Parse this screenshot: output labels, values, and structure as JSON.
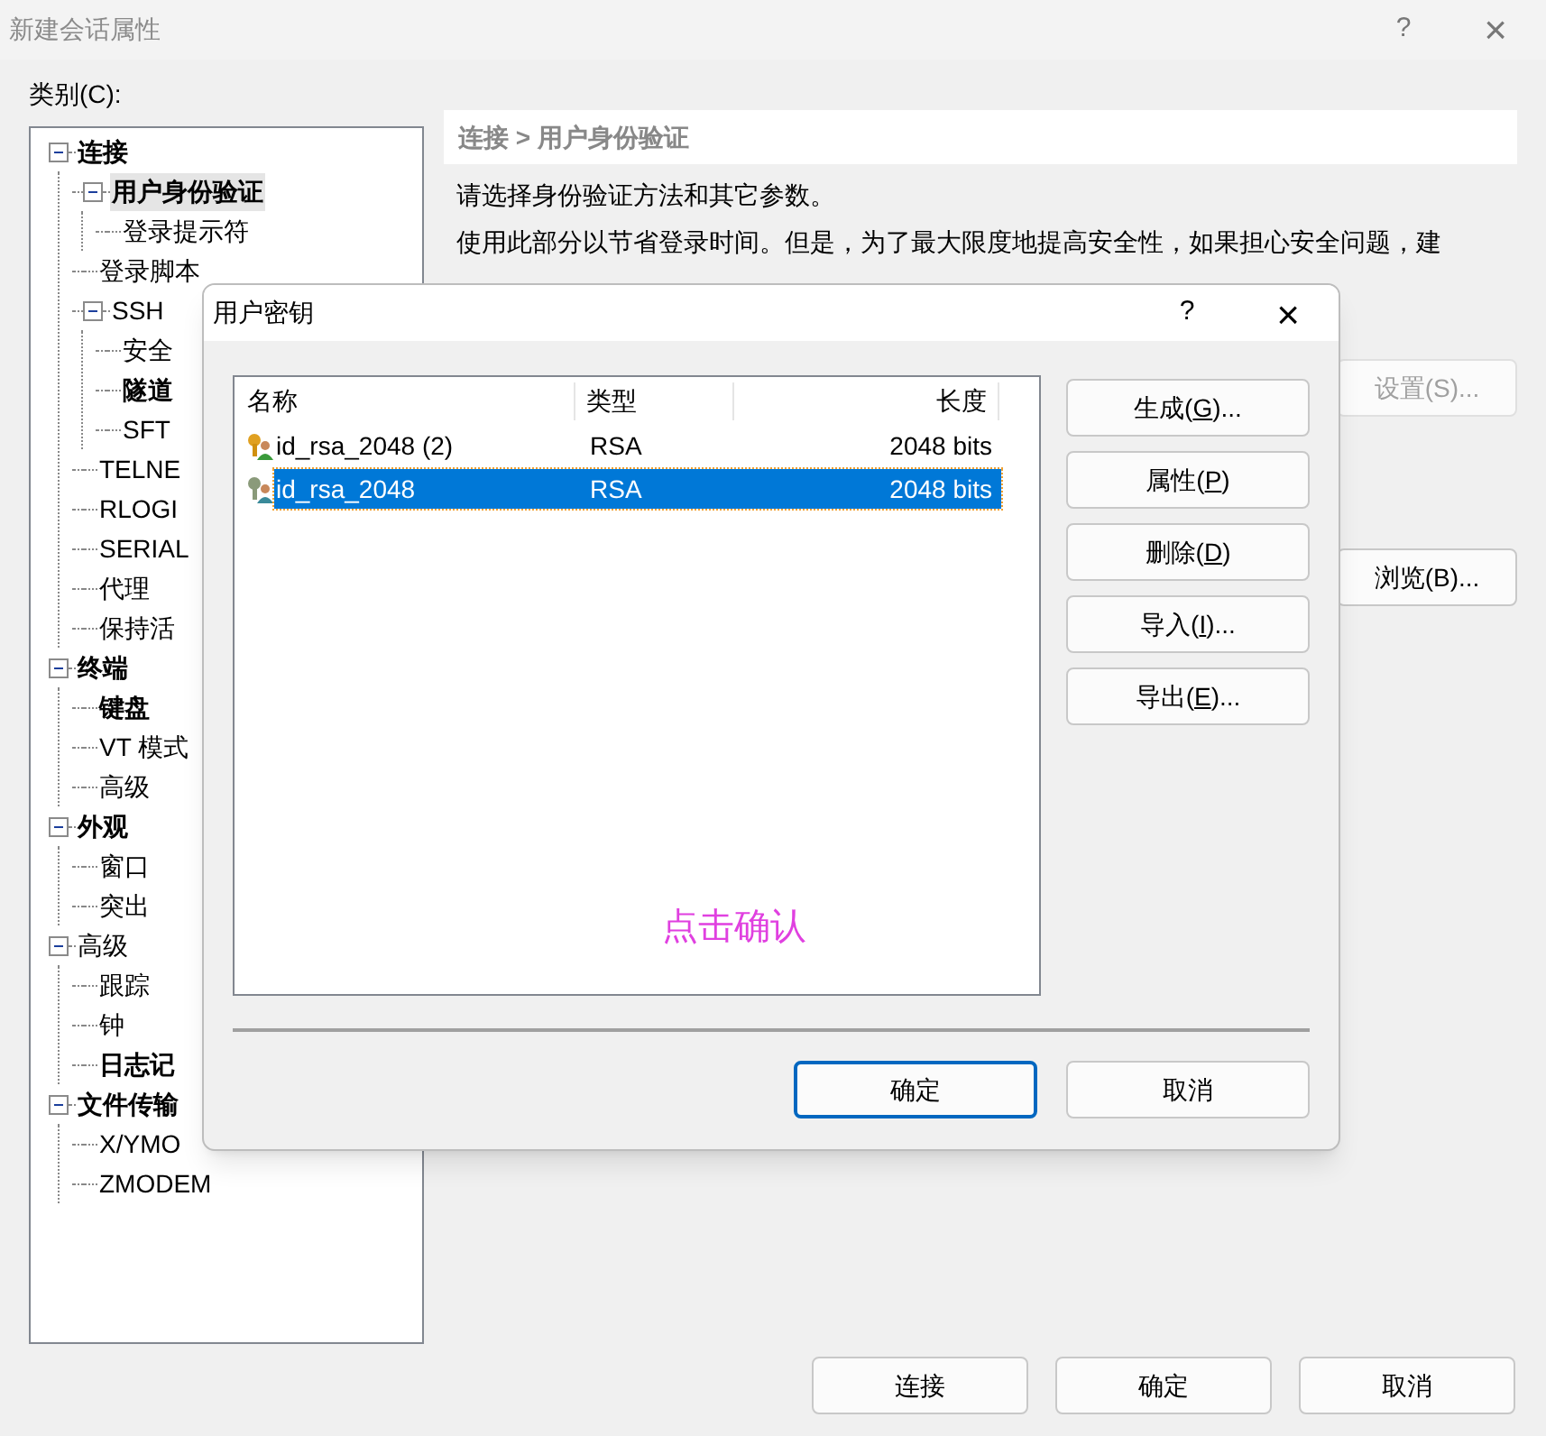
{
  "window": {
    "title": "新建会话属性",
    "help": "?",
    "close": "×"
  },
  "category_label": "类别(C):",
  "tree": [
    {
      "label": "连接",
      "bold": true,
      "expanded": true,
      "selected": false,
      "children": [
        {
          "label": "用户身份验证",
          "bold": true,
          "expanded": true,
          "selected": true,
          "children": [
            {
              "label": "登录提示符",
              "bold": false,
              "selected": false
            }
          ]
        },
        {
          "label": "登录脚本",
          "bold": false,
          "selected": false
        },
        {
          "label": "SSH",
          "bold": false,
          "expanded": true,
          "selected": false,
          "children": [
            {
              "label": "安全",
              "bold": false,
              "selected": false
            },
            {
              "label": "隧道",
              "bold": true,
              "selected": false
            },
            {
              "label": "SFT",
              "bold": false,
              "selected": false
            }
          ]
        },
        {
          "label": "TELNE",
          "bold": false,
          "selected": false
        },
        {
          "label": "RLOGI",
          "bold": false,
          "selected": false
        },
        {
          "label": "SERIAL",
          "bold": false,
          "selected": false
        },
        {
          "label": "代理",
          "bold": false,
          "selected": false
        },
        {
          "label": "保持活",
          "bold": false,
          "selected": false
        }
      ]
    },
    {
      "label": "终端",
      "bold": true,
      "expanded": true,
      "selected": false,
      "children": [
        {
          "label": "键盘",
          "bold": true,
          "selected": false
        },
        {
          "label": "VT 模式",
          "bold": false,
          "selected": false
        },
        {
          "label": "高级",
          "bold": false,
          "selected": false
        }
      ]
    },
    {
      "label": "外观",
      "bold": true,
      "expanded": true,
      "selected": false,
      "children": [
        {
          "label": "窗口",
          "bold": false,
          "selected": false
        },
        {
          "label": "突出",
          "bold": false,
          "selected": false
        }
      ]
    },
    {
      "label": "高级",
      "bold": false,
      "expanded": true,
      "selected": false,
      "children": [
        {
          "label": "跟踪",
          "bold": false,
          "selected": false
        },
        {
          "label": "钟",
          "bold": false,
          "selected": false
        },
        {
          "label": "日志记",
          "bold": true,
          "selected": false
        }
      ]
    },
    {
      "label": "文件传输",
      "bold": true,
      "expanded": true,
      "selected": false,
      "children": [
        {
          "label": "X/YMO",
          "bold": false,
          "selected": false
        },
        {
          "label": "ZMODEM",
          "bold": false,
          "selected": false
        }
      ]
    }
  ],
  "breadcrumb": "连接 > 用户身份验证",
  "description": [
    "请选择身份验证方法和其它参数。",
    "使用此部分以节省登录时间。但是，为了最大限度地提高安全性，如果担心安全问题，建"
  ],
  "background_buttons": [
    {
      "label": "设置(S)...",
      "disabled": true
    },
    {
      "label": "浏览(B)...",
      "disabled": false
    }
  ],
  "footer_buttons": [
    "连接",
    "确定",
    "取消"
  ],
  "dialog": {
    "title": "用户密钥",
    "help": "?",
    "close": "×",
    "columns": [
      "名称",
      "类型",
      "长度"
    ],
    "rows": [
      {
        "name": "id_rsa_2048 (2)",
        "type": "RSA",
        "length": "2048 bits",
        "selected": false
      },
      {
        "name": "id_rsa_2048",
        "type": "RSA",
        "length": "2048 bits",
        "selected": true
      }
    ],
    "annotation": "点击确认",
    "side_buttons": [
      {
        "before": "生成(",
        "key": "G",
        "after": ")..."
      },
      {
        "before": "属性(",
        "key": "P",
        "after": ")"
      },
      {
        "before": "删除(",
        "key": "D",
        "after": ")"
      },
      {
        "before": "导入(",
        "key": "I",
        "after": ")..."
      },
      {
        "before": "导出(",
        "key": "E",
        "after": ")..."
      }
    ],
    "buttons": [
      {
        "label": "确定",
        "default": true
      },
      {
        "label": "取消",
        "default": false
      }
    ]
  }
}
